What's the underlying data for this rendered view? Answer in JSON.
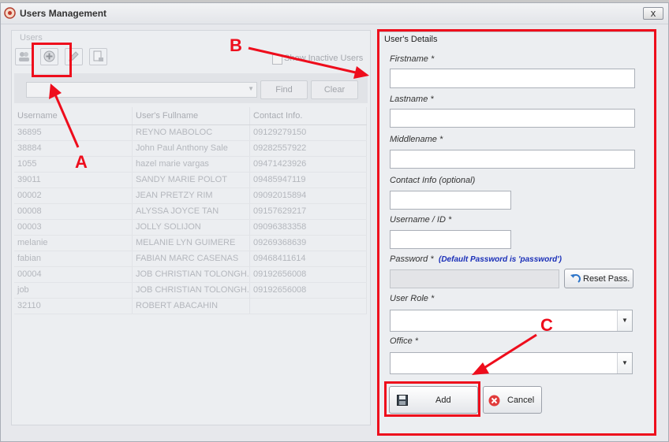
{
  "window": {
    "title": "Users Management",
    "close_label": "x"
  },
  "users_panel": {
    "group_label": "Users",
    "show_inactive_label": "Show Inactive Users",
    "search": {
      "value": "",
      "find_label": "Find",
      "clear_label": "Clear"
    },
    "columns": [
      "Username",
      "User's Fullname",
      "Contact Info."
    ],
    "rows": [
      [
        "36895",
        "REYNO MABOLOC",
        "09129279150"
      ],
      [
        "38884",
        "John Paul Anthony Sale",
        "09282557922"
      ],
      [
        "1055",
        "hazel marie vargas",
        "09471423926"
      ],
      [
        "39011",
        "SANDY MARIE POLOT",
        "09485947119"
      ],
      [
        "00002",
        "JEAN PRETZY RIM",
        "09092015894"
      ],
      [
        "00008",
        "ALYSSA JOYCE TAN",
        "09157629217"
      ],
      [
        "00003",
        "JOLLY SOLIJON",
        "09096383358"
      ],
      [
        "melanie",
        "MELANIE LYN GUIMERE",
        "09269368639"
      ],
      [
        "fabian",
        "FABIAN MARC CASENAS",
        "09468411614"
      ],
      [
        "00004",
        "JOB CHRISTIAN TOLONGH...",
        "09192656008"
      ],
      [
        "job",
        "JOB CHRISTIAN TOLONGH...",
        "09192656008"
      ],
      [
        "32110",
        "ROBERT ABACAHIN",
        ""
      ]
    ]
  },
  "details": {
    "title": "User's Details",
    "firstname_label": "Firstname *",
    "lastname_label": "Lastname *",
    "middlename_label": "Middlename *",
    "contact_label": "Contact Info (optional)",
    "username_label": "Username / ID *",
    "password_label": "Password *",
    "password_note": "(Default Password is 'password')",
    "reset_label": "Reset Pass.",
    "role_label": "User Role *",
    "office_label": "Office *",
    "add_label": "Add",
    "cancel_label": "Cancel",
    "firstname_value": "",
    "lastname_value": "",
    "middlename_value": "",
    "contact_value": "",
    "username_value": "",
    "password_value": "",
    "role_value": "",
    "office_value": ""
  },
  "annotations": {
    "a": "A",
    "b": "B",
    "c": "C",
    "color": "#ee0d1c"
  }
}
